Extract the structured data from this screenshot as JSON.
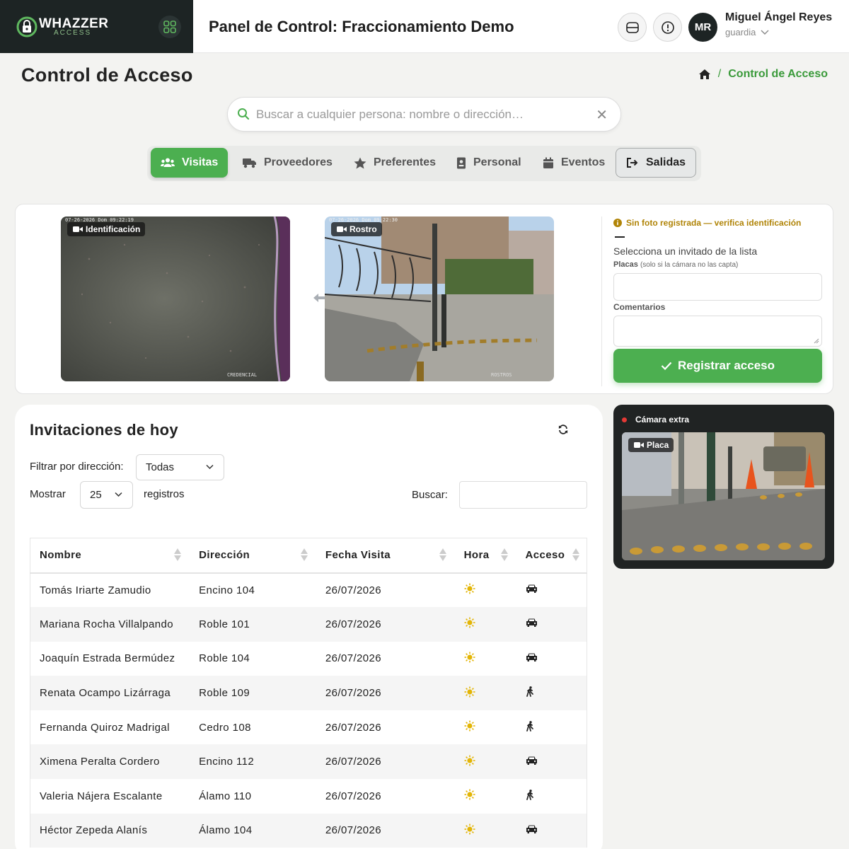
{
  "header": {
    "brand_name": "WHAZZER",
    "brand_sub": "ACCESS",
    "app_title": "Panel de Control: Fraccionamiento Demo",
    "user": {
      "initials": "MR",
      "name": "Miguel Ángel Reyes",
      "role": "guardia"
    }
  },
  "page": {
    "title": "Control de Acceso",
    "breadcrumb": {
      "separator": "/",
      "current": "Control de Acceso"
    }
  },
  "search": {
    "placeholder": "Buscar a cualquier persona: nombre o dirección…",
    "clear": "✕"
  },
  "tabs": [
    {
      "label": "Visitas",
      "icon": "users-icon"
    },
    {
      "label": "Proveedores",
      "icon": "truck-icon"
    },
    {
      "label": "Preferentes",
      "icon": "star-icon"
    },
    {
      "label": "Personal",
      "icon": "badge-icon"
    },
    {
      "label": "Eventos",
      "icon": "calendar-icon"
    },
    {
      "label": "Salidas",
      "icon": "exit-icon"
    }
  ],
  "capture": {
    "cam1": {
      "label": "Identificación",
      "stamp": "07-26-2026 Dom 09:22:19",
      "footer": "CREDENCIAL"
    },
    "cam2": {
      "label": "Rostro",
      "stamp": "07-26-2026 Dom 09:22:30",
      "footer": "ROSTROS"
    },
    "warning": "Sin foto registrada — verifica identificación",
    "hint": "Selecciona un invitado de la lista",
    "placas_label": "Placas",
    "placas_note": "(solo si la cámara no las capta)",
    "comentarios_label": "Comentarios",
    "register_button": "Registrar acceso"
  },
  "invitations": {
    "title": "Invitaciones de hoy",
    "filter_label": "Filtrar por dirección:",
    "filter_value": "Todas",
    "show_label": "Mostrar",
    "show_value": "25",
    "records_label": "registros",
    "search_label": "Buscar:",
    "columns": [
      "Nombre",
      "Dirección",
      "Fecha Visita",
      "Hora",
      "Acceso"
    ],
    "rows": [
      {
        "name": "Tomás Iriarte Zamudio",
        "address": "Encino 104",
        "date": "26/07/2026",
        "access": "car"
      },
      {
        "name": "Mariana Rocha Villalpando",
        "address": "Roble 101",
        "date": "26/07/2026",
        "access": "car"
      },
      {
        "name": "Joaquín Estrada Bermúdez",
        "address": "Roble 104",
        "date": "26/07/2026",
        "access": "car"
      },
      {
        "name": "Renata Ocampo Lizárraga",
        "address": "Roble 109",
        "date": "26/07/2026",
        "access": "walk"
      },
      {
        "name": "Fernanda Quiroz Madrigal",
        "address": "Cedro 108",
        "date": "26/07/2026",
        "access": "walk"
      },
      {
        "name": "Ximena Peralta Cordero",
        "address": "Encino 112",
        "date": "26/07/2026",
        "access": "car"
      },
      {
        "name": "Valeria Nájera Escalante",
        "address": "Álamo 110",
        "date": "26/07/2026",
        "access": "walk"
      },
      {
        "name": "Héctor Zepeda Alanís",
        "address": "Álamo 104",
        "date": "26/07/2026",
        "access": "car"
      }
    ]
  },
  "extra_camera": {
    "title": "Cámara extra",
    "label": "Placa"
  },
  "colors": {
    "accent": "#4caf50",
    "brand_dark": "#1d2424",
    "warning": "#b08407",
    "sun": "#e3b506"
  }
}
